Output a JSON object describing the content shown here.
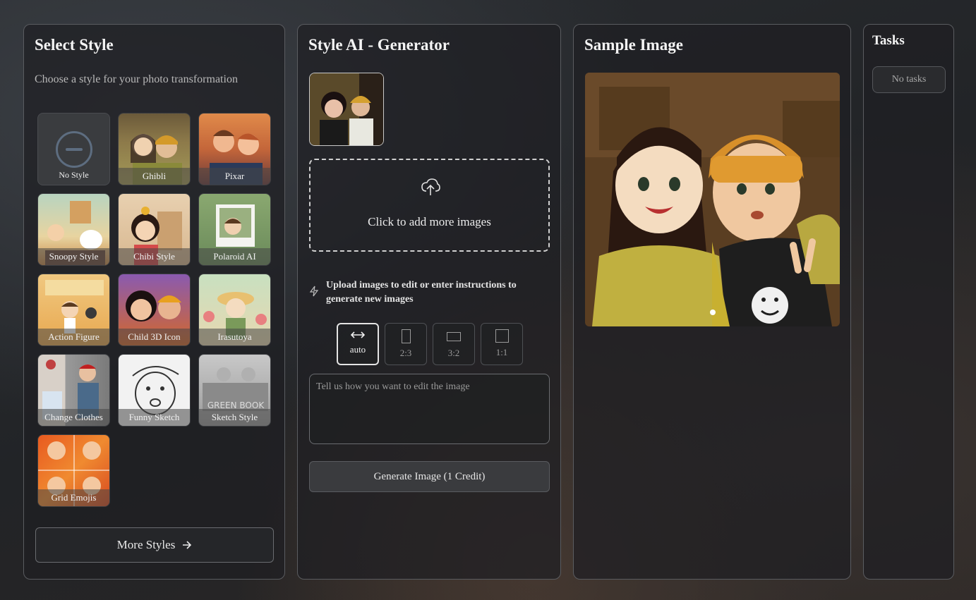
{
  "select_style": {
    "title": "Select Style",
    "subtitle": "Choose a style for your photo transformation",
    "styles": [
      {
        "label": "No Style"
      },
      {
        "label": "Ghibli"
      },
      {
        "label": "Pixar"
      },
      {
        "label": "Snoopy Style"
      },
      {
        "label": "Chibi Style"
      },
      {
        "label": "Polaroid AI"
      },
      {
        "label": "Action Figure"
      },
      {
        "label": "Child 3D Icon"
      },
      {
        "label": "Irasutoya"
      },
      {
        "label": "Change Clothes"
      },
      {
        "label": "Funny Sketch"
      },
      {
        "label": "Sketch Style"
      },
      {
        "label": "Grid Emojis"
      }
    ],
    "more_styles": "More Styles"
  },
  "generator": {
    "title": "Style AI - Generator",
    "dropzone_text": "Click to add more images",
    "hint": "Upload images to edit or enter instructions to generate new images",
    "ratios": [
      {
        "label": "auto",
        "icon": "arrows-horizontal-icon"
      },
      {
        "label": "2:3",
        "icon": "portrait-rect-icon"
      },
      {
        "label": "3:2",
        "icon": "landscape-rect-icon"
      },
      {
        "label": "1:1",
        "icon": "square-icon"
      }
    ],
    "prompt_placeholder": "Tell us how you want to edit the image",
    "generate_button": "Generate Image (1 Credit)"
  },
  "sample": {
    "title": "Sample Image"
  },
  "tasks": {
    "title": "Tasks",
    "empty": "No tasks"
  }
}
